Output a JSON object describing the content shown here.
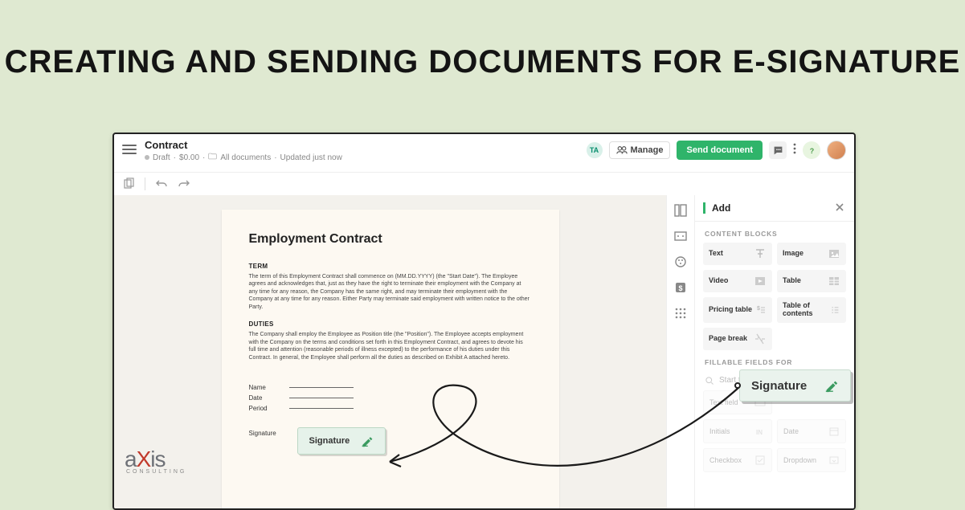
{
  "hero": {
    "title": "CREATING AND SENDING DOCUMENTS FOR E-SIGNATURE"
  },
  "header": {
    "title": "Contract",
    "status": "Draft",
    "price": "$0.00",
    "folder": "All documents",
    "updated": "Updated just now",
    "avatar_initials": "TA",
    "manage_label": "Manage",
    "send_label": "Send document"
  },
  "document": {
    "heading": "Employment  Contract",
    "section1_title": "TERM",
    "section1_body": "The term of this Employment Contract shall commence on (MM.DD.YYYY)\n(the \"Start Date\"). The Employee agrees and acknowledges that, just as they have the right to terminate their employment with the Company at any time for any reason, the Company has the same right, and may terminate their employment with the Company at any time for any reason. Either Party may terminate said employment with written notice to the other Party.",
    "section2_title": "DUTIES",
    "section2_body": "The Company shall employ the Employee as Position title (the \"Position\").\nThe Employee accepts employment with the Company on the terms and conditions set forth in this Employment Contract, and agrees to devote his full time and attention (reasonable periods of illness excepted) to the performance of his duties under this Contract. In general, the Employee shall perform all the duties as described on Exhibit A attached hereto.",
    "fields": {
      "name": "Name",
      "date": "Date",
      "period": "Period",
      "signature": "Signature"
    },
    "sig_drop_label": "Signature"
  },
  "sidebar": {
    "tab_title": "Add",
    "section_blocks": "CONTENT BLOCKS",
    "blocks": {
      "text": "Text",
      "image": "Image",
      "video": "Video",
      "table": "Table",
      "pricing": "Pricing table",
      "toc": "Table of contents",
      "pagebreak": "Page break"
    },
    "section_fields": "FILLABLE FIELDS FOR",
    "search_placeholder": "Start typing na",
    "fields": {
      "textfield": "Text field",
      "signature": "Signature",
      "initials": "Initials",
      "date": "Date",
      "checkbox": "Checkbox",
      "dropdown": "Dropdown"
    }
  },
  "floating": {
    "label": "Signature"
  },
  "brand": {
    "name_pre": "a",
    "name_x": "X",
    "name_post": "is",
    "sub": "CONSULTING"
  }
}
